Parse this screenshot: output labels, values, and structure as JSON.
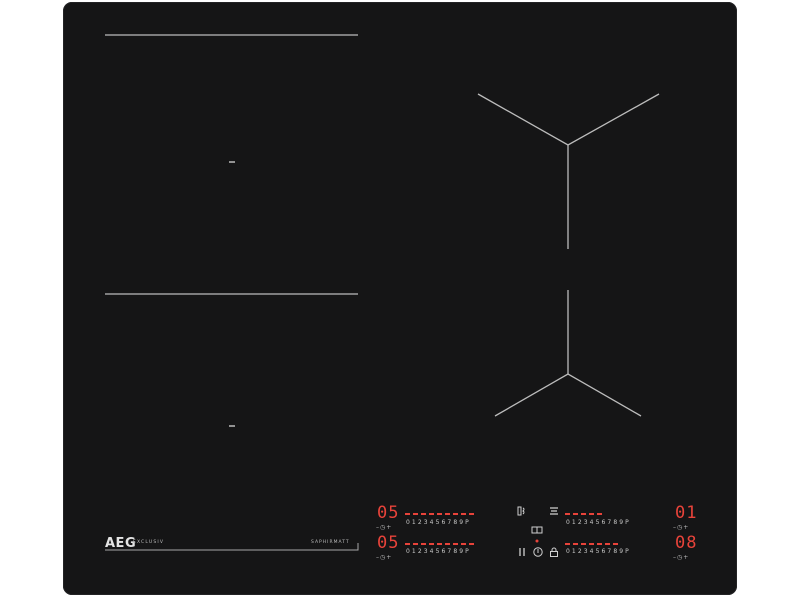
{
  "brand": {
    "logo": "AEG",
    "series": "EXCLUSIV",
    "surface": "SAPHIRMATT"
  },
  "zones": {
    "front_left": {
      "level": "05",
      "scale": "0123456789P",
      "timer": "–◷+"
    },
    "rear_left": {
      "level": "05",
      "scale": "0123456789P",
      "timer": "–◷+"
    },
    "rear_right": {
      "level": "01",
      "scale": "0123456789P",
      "timer": "–◷+"
    },
    "front_right": {
      "level": "08",
      "scale": "0123456789P",
      "timer": "–◷+"
    }
  },
  "controls": {
    "hob2hood": "hob2hood-icon",
    "bridge": "bridge-icon",
    "pause": "pause-icon",
    "lock": "lock-icon",
    "power": "power-icon"
  },
  "colors": {
    "surface": "#151516",
    "display": "#e8433a",
    "markings": "#c9c9c9"
  }
}
